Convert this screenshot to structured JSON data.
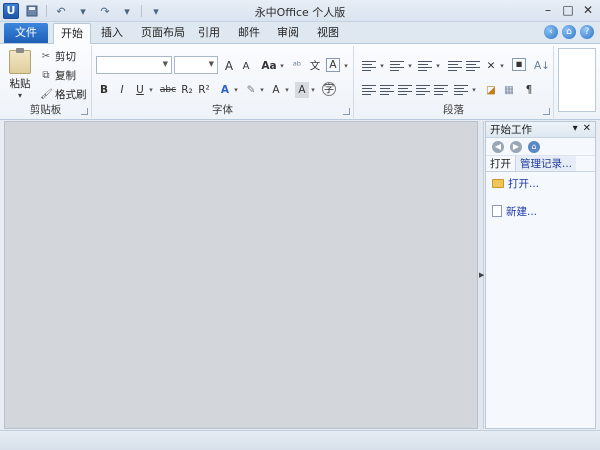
{
  "window": {
    "title": "永中Office 个人版"
  },
  "qat": {
    "logo": "U"
  },
  "tabs": {
    "file": "文件",
    "items": [
      {
        "label": "开始",
        "active": true
      },
      {
        "label": "插入"
      },
      {
        "label": "页面布局"
      },
      {
        "label": "引用"
      },
      {
        "label": "邮件"
      },
      {
        "label": "审阅"
      },
      {
        "label": "视图"
      }
    ]
  },
  "ribbon": {
    "clipboard": {
      "paste": "粘贴",
      "cut": "剪切",
      "copy": "复制",
      "format_painter": "格式刷",
      "label": "剪贴板"
    },
    "font": {
      "label": "字体",
      "font_name": "",
      "font_size": "",
      "grow": "A",
      "shrink": "A",
      "change_case": "Aa",
      "bold": "B",
      "italic": "I",
      "underline": "U",
      "strike": "abc",
      "subscript": "R₂",
      "superscript": "R²",
      "text_effect": "A",
      "font_color": "A",
      "char_shading": "A"
    },
    "paragraph": {
      "label": "段落",
      "pilcrow": "¶"
    }
  },
  "taskpane": {
    "title": "开始工作",
    "tab_open": "打开",
    "tab_manage": "管理记录...",
    "open_link": "打开...",
    "new_link": "新建..."
  }
}
